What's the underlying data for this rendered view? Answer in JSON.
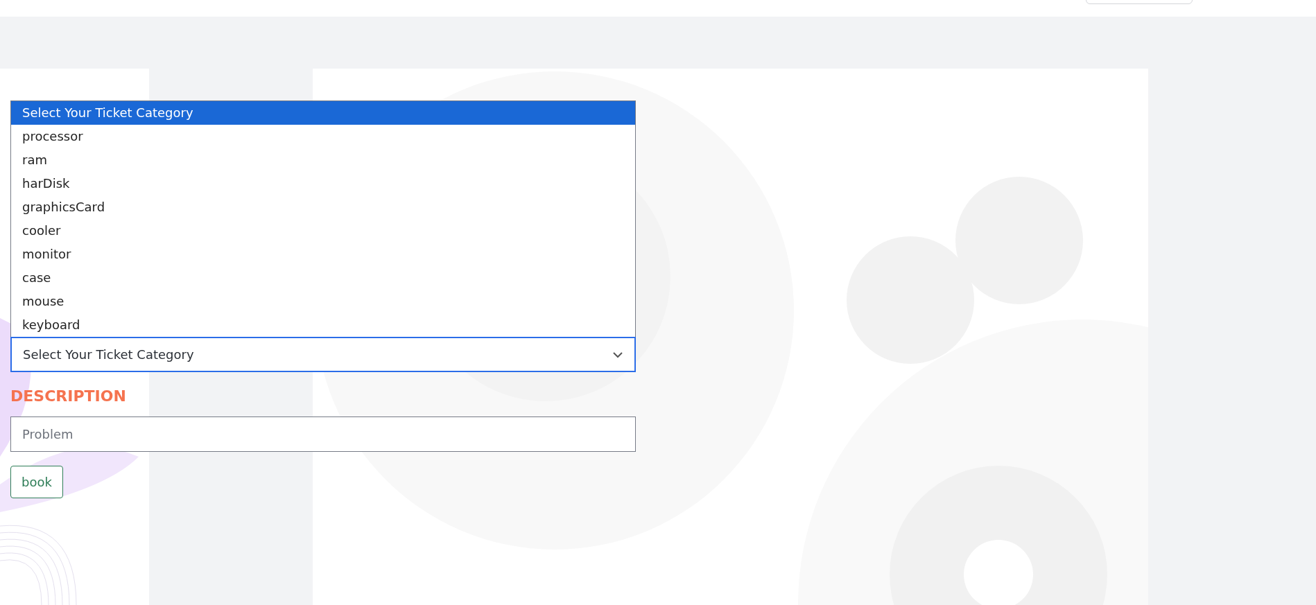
{
  "category_select": {
    "expanded": true,
    "value": "Select Your Ticket Category",
    "options": [
      {
        "label": "Select Your Ticket Category",
        "selected": true
      },
      {
        "label": "processor",
        "selected": false
      },
      {
        "label": "ram",
        "selected": false
      },
      {
        "label": "harDisk",
        "selected": false
      },
      {
        "label": "graphicsCard",
        "selected": false
      },
      {
        "label": "cooler",
        "selected": false
      },
      {
        "label": "monitor",
        "selected": false
      },
      {
        "label": "case",
        "selected": false
      },
      {
        "label": "mouse",
        "selected": false
      },
      {
        "label": "keyboard",
        "selected": false
      }
    ]
  },
  "description": {
    "label": "DESCRIPTION",
    "placeholder": "Problem"
  },
  "submit_button": {
    "label": "book"
  }
}
